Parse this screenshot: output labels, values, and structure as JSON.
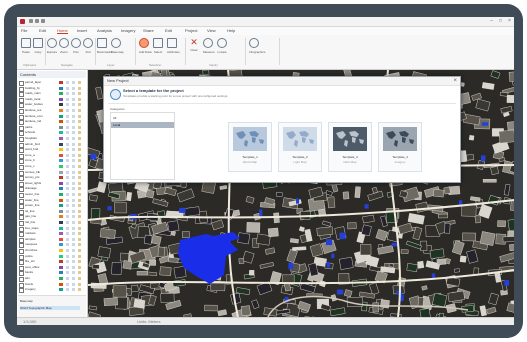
{
  "app": {
    "window_title": ""
  },
  "tabs": [
    "File",
    "Edit",
    "Home",
    "Insert",
    "Analysis",
    "Imagery",
    "Share",
    "Edit",
    "Project",
    "View",
    "Help"
  ],
  "active_tab_index": 2,
  "ribbon_groups": [
    {
      "label": "Clipboard"
    },
    {
      "label": "Navigate"
    },
    {
      "label": "Layer"
    },
    {
      "label": "Selection"
    },
    {
      "label": "Inquiry"
    }
  ],
  "ribbon_buttons": [
    {
      "label": "Paste",
      "icon": "paste-icon"
    },
    {
      "label": "Copy",
      "icon": "copy-icon"
    },
    {
      "label": "Explore",
      "icon": "hand-icon"
    },
    {
      "label": "Zoom",
      "icon": "zoom-icon"
    },
    {
      "label": "Pan",
      "icon": "pan-icon"
    },
    {
      "label": "Full",
      "icon": "globe-icon"
    },
    {
      "label": "Bookmarks",
      "icon": "bookmark-icon"
    },
    {
      "label": "Basemap",
      "icon": "basemap-icon"
    },
    {
      "label": "Add Data",
      "icon": "add-data-icon"
    },
    {
      "label": "Select",
      "icon": "select-icon"
    },
    {
      "label": "Attributes",
      "icon": "table-icon"
    },
    {
      "label": "Clear",
      "icon": "clear-icon"
    },
    {
      "label": "Measure",
      "icon": "measure-icon"
    },
    {
      "label": "Locate",
      "icon": "locate-icon"
    },
    {
      "label": "Infographics",
      "icon": "info-icon"
    }
  ],
  "sidebar": {
    "title": "Contents",
    "layers": [
      {
        "name": "parcel_layer",
        "color": "#c0392b"
      },
      {
        "name": "building_fp",
        "color": "#2980b9"
      },
      {
        "name": "roads_main",
        "color": "#27ae60"
      },
      {
        "name": "roads_local",
        "color": "#8e44ad"
      },
      {
        "name": "water_bodies",
        "color": "#2c3e50"
      },
      {
        "name": "landuse_res",
        "color": "#e67e22"
      },
      {
        "name": "landuse_com",
        "color": "#16a085"
      },
      {
        "name": "landuse_ind",
        "color": "#d35400"
      },
      {
        "name": "parks",
        "color": "#7f8c8d"
      },
      {
        "name": "schools",
        "color": "#1abc9c"
      },
      {
        "name": "hospitals",
        "color": "#9b59b6"
      },
      {
        "name": "admin_bnd",
        "color": "#34495e"
      },
      {
        "name": "ward_bnd",
        "color": "#f1c40f"
      },
      {
        "name": "zone_a",
        "color": "#e74c3c"
      },
      {
        "name": "zone_b",
        "color": "#3498db"
      },
      {
        "name": "zone_c",
        "color": "#2ecc71"
      },
      {
        "name": "census_blk",
        "color": "#95a5a6"
      },
      {
        "name": "survey_pts",
        "color": "#c0392b"
      },
      {
        "name": "street_lights",
        "color": "#8e44ad"
      },
      {
        "name": "drainage",
        "color": "#2980b9"
      },
      {
        "name": "sewer_line",
        "color": "#27ae60"
      },
      {
        "name": "water_line",
        "color": "#d35400"
      },
      {
        "name": "power_line",
        "color": "#16a085"
      },
      {
        "name": "tel_line",
        "color": "#7f8c8d"
      },
      {
        "name": "gas_line",
        "color": "#e67e22"
      },
      {
        "name": "rail_line",
        "color": "#2c3e50"
      },
      {
        "name": "bus_stops",
        "color": "#1abc9c"
      },
      {
        "name": "markets",
        "color": "#9b59b6"
      },
      {
        "name": "temples",
        "color": "#e74c3c"
      },
      {
        "name": "mosques",
        "color": "#3498db"
      },
      {
        "name": "churches",
        "color": "#f1c40f"
      },
      {
        "name": "police",
        "color": "#2ecc71"
      },
      {
        "name": "fire_stn",
        "color": "#c0392b"
      },
      {
        "name": "post_office",
        "color": "#8e44ad"
      },
      {
        "name": "banks",
        "color": "#2980b9"
      },
      {
        "name": "atm",
        "color": "#27ae60"
      },
      {
        "name": "hotels",
        "color": "#d35400"
      },
      {
        "name": "imagery",
        "color": "#16a085"
      }
    ],
    "footer_items": [
      "Basemap",
      "World Topographic Map"
    ]
  },
  "dialog": {
    "title": "New Project",
    "heading": "Select a template for the project",
    "subheading": "Templates provide a starting point for a new project with preconfigured settings.",
    "category_label": "Categories",
    "categories": [
      "All",
      "Local"
    ],
    "templates": [
      {
        "name": "Template_1",
        "sub": "World Map",
        "palette": [
          "#b8c9de",
          "#6f8fb7"
        ]
      },
      {
        "name": "Template_2",
        "sub": "Light Map",
        "palette": [
          "#cfdbe8",
          "#93abc8"
        ]
      },
      {
        "name": "Template_3",
        "sub": "Dark Map",
        "palette": [
          "#4d5a67",
          "#b9c4cf"
        ]
      },
      {
        "name": "Template_4",
        "sub": "Imagery",
        "palette": [
          "#9aa5b0",
          "#3c4b5a"
        ]
      }
    ]
  },
  "status": {
    "scale": "1:5,000",
    "coords": "Units: Meters"
  }
}
